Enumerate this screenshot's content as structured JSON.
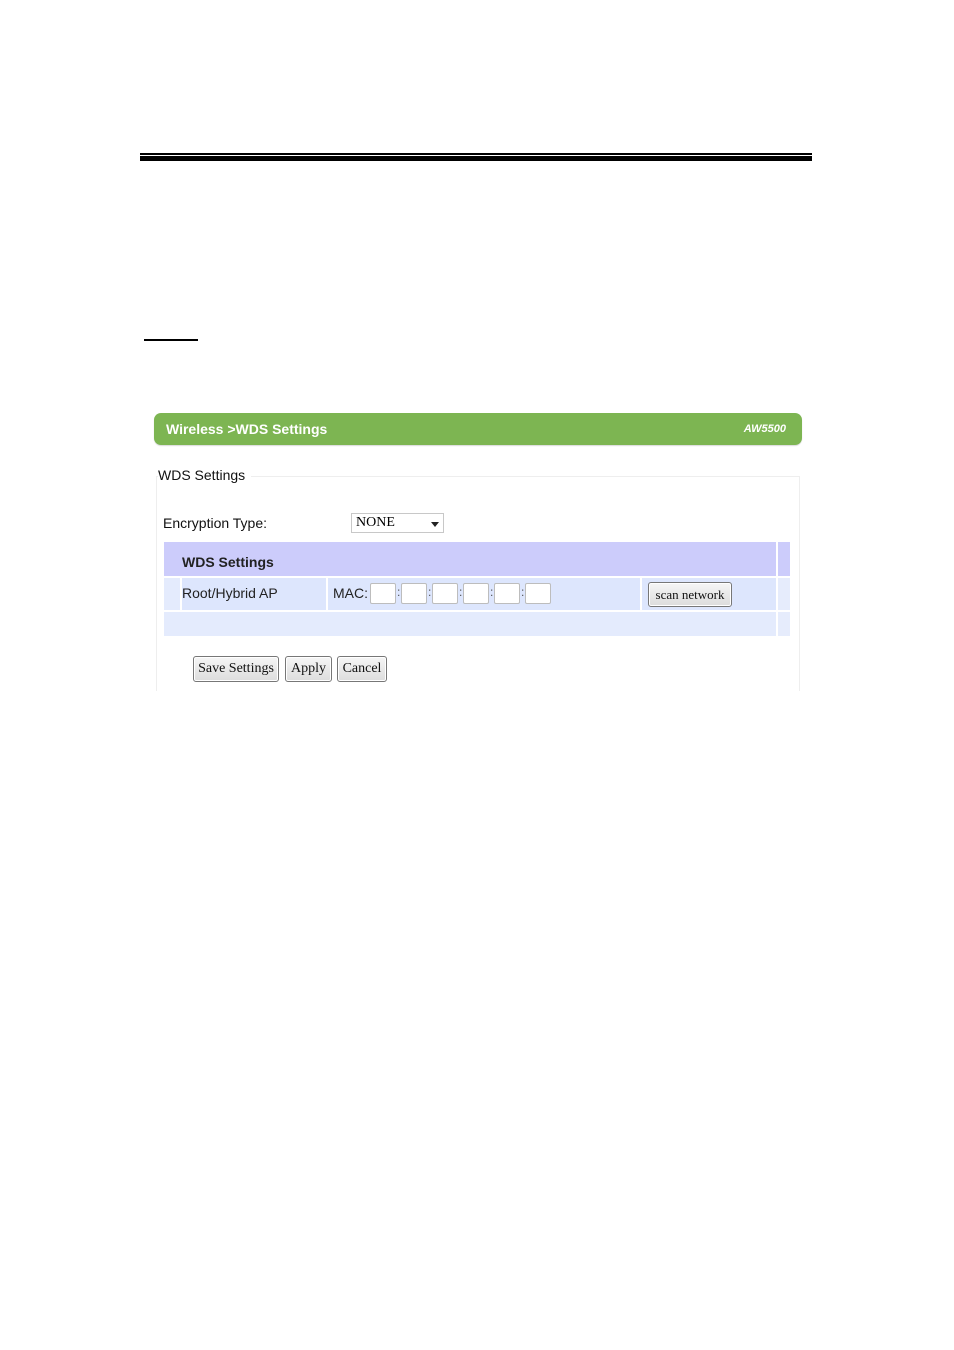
{
  "header": {
    "breadcrumb": "Wireless >WDS Settings",
    "model": "AW5500"
  },
  "fieldset": {
    "legend": "WDS Settings"
  },
  "encryption": {
    "label": "Encryption Type:",
    "selected": "NONE"
  },
  "table": {
    "header": "WDS Settings",
    "rows": [
      {
        "label": "Root/Hybrid AP",
        "mac_label": "MAC:",
        "mac_octets": [
          "",
          "",
          "",
          "",
          "",
          ""
        ],
        "mac_separator": ":",
        "action_label": "scan network"
      }
    ]
  },
  "actions": {
    "save_label": "Save Settings",
    "apply_label": "Apply",
    "cancel_label": "Cancel"
  },
  "colors": {
    "title_bar": "#7db552",
    "table_header": "#ccccfb",
    "table_row": "#dde6fd"
  }
}
